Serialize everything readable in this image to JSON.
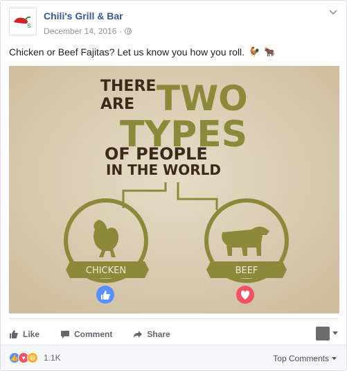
{
  "page": {
    "name": "Chili's Grill & Bar",
    "date": "December 14, 2016",
    "separator": "·"
  },
  "post": {
    "text": "Chicken or Beef Fajitas? Let us know you how you roll.",
    "emojis": [
      "rooster",
      "ox"
    ]
  },
  "image": {
    "line1": "THERE",
    "line1b": "TWO",
    "line2": "ARE",
    "line3": "TYPES",
    "line4": "OF PEOPLE",
    "line5": "IN THE WORLD",
    "left_option": "CHICKEN",
    "right_option": "BEEF",
    "left_reaction": "like-icon",
    "right_reaction": "love-icon",
    "colors": {
      "background": "#d9ccb4",
      "olive": "#8c8a3a",
      "dark": "#3a2a1c",
      "blue": "#5890ff",
      "red": "#f25268"
    }
  },
  "actions": {
    "like": "Like",
    "comment": "Comment",
    "share": "Share"
  },
  "footer": {
    "count": "1.1K",
    "sort_label": "Top Comments"
  }
}
